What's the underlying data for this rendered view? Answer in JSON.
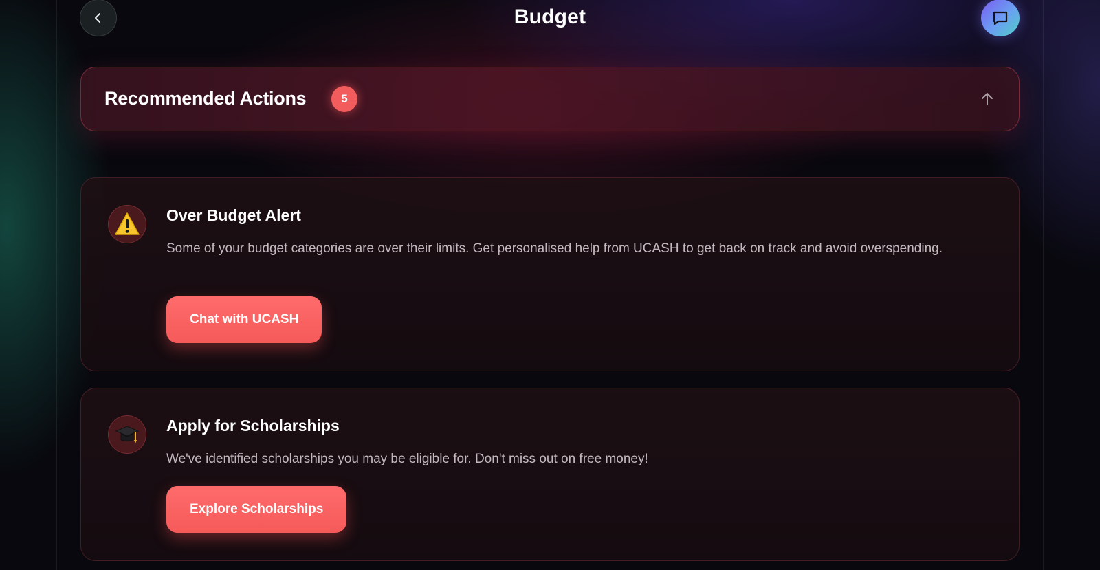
{
  "header": {
    "title": "Budget",
    "back_icon": "chevron-left-icon",
    "chat_icon": "chat-bubble-icon"
  },
  "recommended": {
    "title": "Recommended Actions",
    "count": "5",
    "collapse_icon": "arrow-up-icon"
  },
  "actions": [
    {
      "icon": "warning-icon",
      "title": "Over Budget Alert",
      "description": "Some of your budget categories are over their limits. Get personalised help from UCASH to get back on track and avoid overspending.",
      "button_label": "Chat with UCASH"
    },
    {
      "icon": "graduation-cap-icon",
      "title": "Apply for Scholarships",
      "description": "We've identified scholarships you may be eligible for. Don't miss out on free money!",
      "button_label": "Explore Scholarships"
    }
  ],
  "colors": {
    "accent": "#f55a5a",
    "badge": "#f25c5c",
    "chat_gradient_start": "#7a5cf0",
    "chat_gradient_end": "#4fd1c5"
  }
}
